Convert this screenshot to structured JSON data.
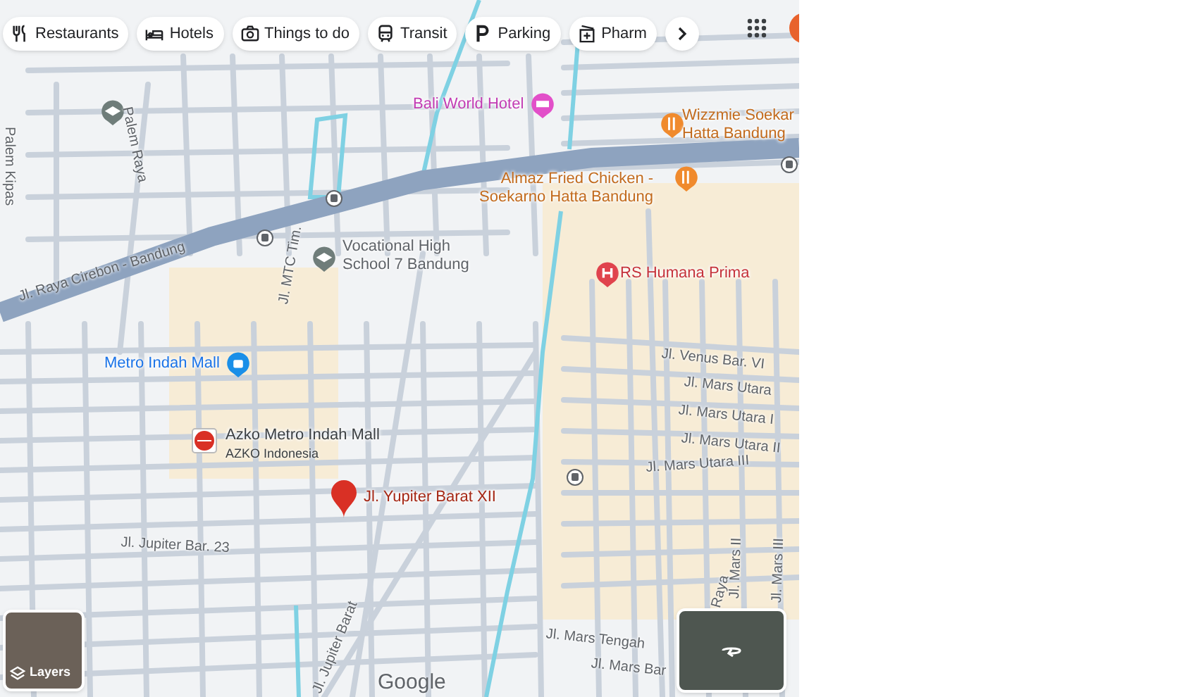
{
  "category_chips": [
    {
      "label": "Restaurants"
    },
    {
      "label": "Hotels"
    },
    {
      "label": "Things to do"
    },
    {
      "label": "Transit"
    },
    {
      "label": "Parking"
    },
    {
      "label": "Pharm"
    }
  ],
  "map": {
    "places": [
      {
        "kind": "hotel",
        "name": "Bali World Hotel"
      },
      {
        "kind": "restaurant",
        "name": "Wizzmie Soekar\nHatta Bandung"
      },
      {
        "kind": "restaurant",
        "name": "Almaz Fried Chicken -\nSoekarno Hatta Bandung"
      },
      {
        "kind": "school",
        "name": "Vocational High\nSchool 7 Bandung"
      },
      {
        "kind": "hospital",
        "name": "RS Humana Prima"
      },
      {
        "kind": "mall",
        "name": "Metro Indah Mall"
      },
      {
        "kind": "store",
        "name": "Azko Metro Indah Mall",
        "subtitle": "AZKO Indonesia"
      },
      {
        "kind": "pin",
        "name": "Jl. Yupiter Barat XII"
      }
    ],
    "streets": [
      {
        "name": "Palem Kipas"
      },
      {
        "name": "Palem Raya"
      },
      {
        "name": "Jl. Raya Cirebon - Bandung"
      },
      {
        "name": "Jl. MTC Tim."
      },
      {
        "name": "Jl. Venus Bar. VI"
      },
      {
        "name": "Jl. Mars Utara"
      },
      {
        "name": "Jl. Mars Utara I"
      },
      {
        "name": "Jl. Mars Utara II"
      },
      {
        "name": "Jl. Mars Utara III"
      },
      {
        "name": "Jl. Jupiter Bar. 23"
      },
      {
        "name": "Jl. Jupiter Barat"
      },
      {
        "name": "Raya"
      },
      {
        "name": "Jl. Mars II"
      },
      {
        "name": "Jl. Mars III"
      },
      {
        "name": "Jl. Mars Tengah"
      },
      {
        "name": "Jl. Mars Bar"
      }
    ],
    "logo": "Google"
  },
  "layers_button": {
    "label": "Layers"
  }
}
